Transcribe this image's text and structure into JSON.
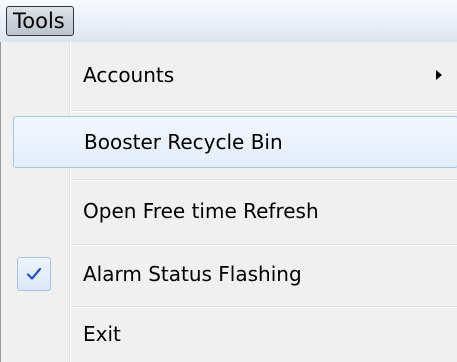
{
  "menubar": {
    "tools_label": "Tools"
  },
  "menu": {
    "items": [
      {
        "label": "Accounts",
        "has_submenu": true
      },
      {
        "label": "Booster Recycle Bin",
        "highlighted": true
      },
      {
        "label": "Open Free time Refresh"
      },
      {
        "label": "Alarm Status Flashing",
        "checked": true
      },
      {
        "label": "Exit"
      }
    ]
  },
  "colors": {
    "highlight_border": "#a9c3e6",
    "check_color": "#1e55c8",
    "menu_background": "#f0f0f0"
  }
}
